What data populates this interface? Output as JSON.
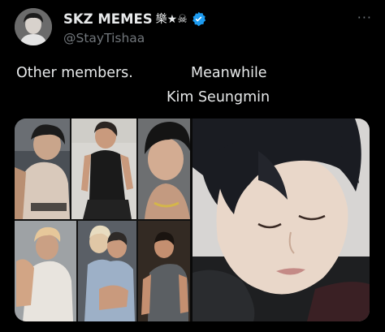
{
  "user": {
    "display_name": "SKZ MEMES",
    "name_emoji": "樂★☠",
    "handle": "@StayTishaa",
    "verified": true,
    "verified_color": "#1d9bf0"
  },
  "tweet": {
    "line1": "Other members.",
    "line2": "Meanwhile",
    "line3": "Kim Seungmin"
  },
  "menu": {
    "more_label": "···"
  },
  "media": {
    "panel_caption": "[★★★★] ★"
  }
}
